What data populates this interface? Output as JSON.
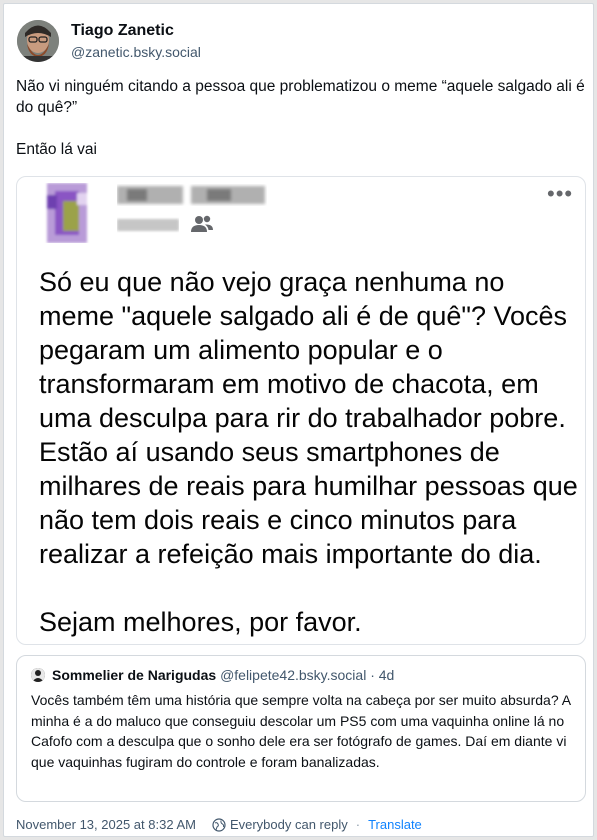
{
  "post": {
    "author_name": "Tiago Zanetic",
    "author_handle": "@zanetic.bsky.social",
    "text_line1": "Não vi ninguém citando a pessoa que problematizou o meme “aquele salgado ali é do quê?”",
    "text_line2": "Então lá vai"
  },
  "embedded_image": {
    "paragraph1": "Só eu que não vejo graça nenhuma no meme \"aquele salgado ali é de quê\"? Vocês pegaram um alimento popular e o transformaram em motivo de chacota, em uma desculpa para rir do trabalhador pobre. Estão aí usando seus smartphones de milhares de reais para humilhar pessoas que não tem dois reais e cinco minutos para realizar a refeição mais importante do dia.",
    "paragraph2": "Sejam melhores, por favor.",
    "more_icon": "more-horizontal-icon",
    "group_icon": "people-icon"
  },
  "quote": {
    "author_name": "Sommelier de Narigudas",
    "author_handle": "@felipete42.bsky.social",
    "separator": "·",
    "age": "4d",
    "text": "Vocês também têm uma história que sempre volta na cabeça por ser muito absurda? A minha é a do maluco que conseguiu descolar um PS5 com uma vaquinha online lá no Cafofo com a desculpa que o sonho dele era ser fotógrafo de games. Daí em diante vi que vaquinhas fugiram do controle e foram banalizadas."
  },
  "footer": {
    "timestamp": "November 13, 2025 at 8:32 AM",
    "reply_setting": "Everybody can reply",
    "separator": "·",
    "translate_label": "Translate"
  },
  "colors": {
    "link": "#1083fe",
    "muted": "#42576c",
    "border": "#d4d9de"
  }
}
